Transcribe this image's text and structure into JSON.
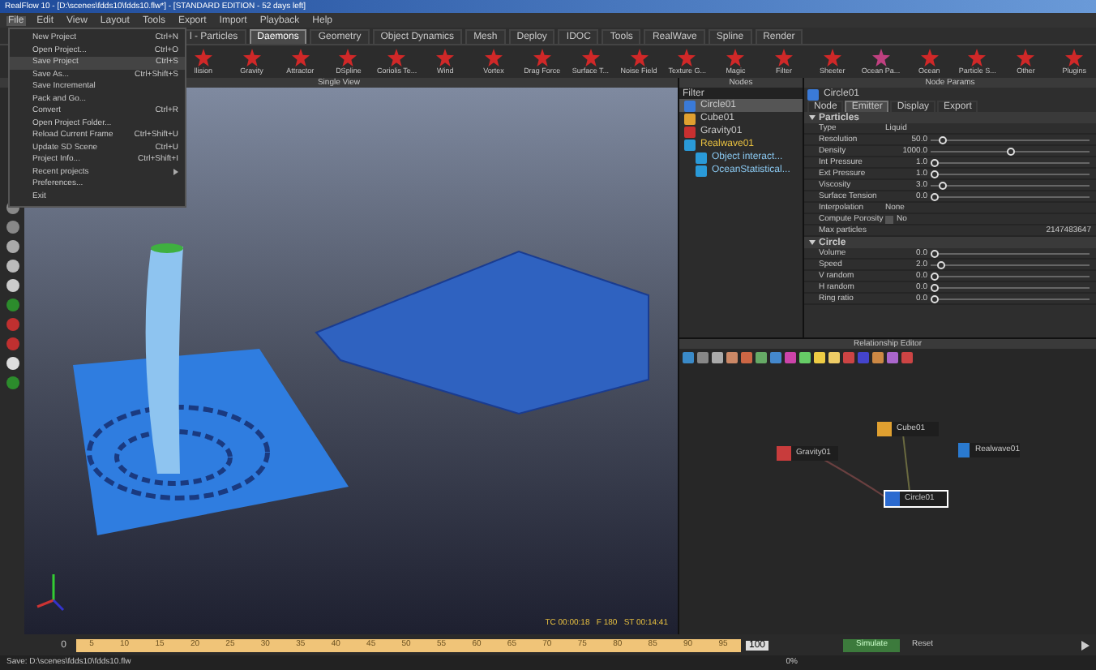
{
  "window": {
    "title": "RealFlow 10 - [D:\\scenes\\fdds10\\fdds10.flw*] - [STANDARD EDITION - 52 days left]"
  },
  "menu_bar": [
    {
      "label": "File",
      "selected": true
    },
    {
      "label": "Edit",
      "selected": false
    },
    {
      "label": "View",
      "selected": false
    },
    {
      "label": "Layout",
      "selected": false
    },
    {
      "label": "Tools",
      "selected": false
    },
    {
      "label": "Export",
      "selected": false
    },
    {
      "label": "Import",
      "selected": false
    },
    {
      "label": "Playback",
      "selected": false
    },
    {
      "label": "Help",
      "selected": false
    }
  ],
  "file_menu": [
    {
      "kind": "item",
      "label": "New Project",
      "shortcut": "Ctrl+N",
      "selected": false
    },
    {
      "kind": "item",
      "label": "Open Project...",
      "shortcut": "Ctrl+O",
      "selected": false
    },
    {
      "kind": "item",
      "label": "Save Project",
      "shortcut": "Ctrl+S",
      "selected": true
    },
    {
      "kind": "item",
      "label": "Save As...",
      "shortcut": "Ctrl+Shift+S",
      "selected": false
    },
    {
      "kind": "item",
      "label": "Save Incremental",
      "selected": false
    },
    {
      "kind": "item",
      "label": "Pack and Go...",
      "selected": false
    },
    {
      "kind": "item",
      "label": "Convert",
      "shortcut": "Ctrl+R",
      "selected": false
    },
    {
      "kind": "item",
      "label": "Open Project Folder...",
      "selected": false
    },
    {
      "kind": "item",
      "label": "Reload Current Frame",
      "shortcut": "Ctrl+Shift+U",
      "selected": false
    },
    {
      "kind": "item",
      "label": "Update SD Scene",
      "shortcut": "Ctrl+U",
      "selected": false
    },
    {
      "kind": "item",
      "label": "Project Info...",
      "shortcut": "Ctrl+Shift+I",
      "selected": false
    },
    {
      "kind": "submenu",
      "label": "Recent projects",
      "selected": false
    },
    {
      "kind": "item",
      "label": "Preferences...",
      "selected": false
    },
    {
      "kind": "item",
      "label": "Exit",
      "selected": false
    }
  ],
  "tabs": [
    {
      "label": "l - Particles",
      "selected": false
    },
    {
      "label": "Daemons",
      "selected": true
    },
    {
      "label": "Geometry",
      "selected": false
    },
    {
      "label": "Object Dynamics",
      "selected": false
    },
    {
      "label": "Mesh",
      "selected": false
    },
    {
      "label": "Deploy",
      "selected": false
    },
    {
      "label": "IDOC",
      "selected": false
    },
    {
      "label": "Tools",
      "selected": false
    },
    {
      "label": "RealWave",
      "selected": false
    },
    {
      "label": "Spline",
      "selected": false
    },
    {
      "label": "Render",
      "selected": false
    }
  ],
  "toolbar": [
    "llision",
    "Gravity",
    "Attractor",
    "DSpline",
    "Coriolis Te...",
    "Wind",
    "Vortex",
    "Drag Force",
    "Surface T...",
    "Noise Field",
    "Texture G...",
    "Magic",
    "Filter",
    "Sheeter",
    "Ocean Pa...",
    "Ocean",
    "Particle S...",
    "Other",
    "Plugins"
  ],
  "viewport": {
    "title": "Single View",
    "readout": "TC 00:00:18   F 180   ST 00:14:41"
  },
  "nodes": {
    "title": "Nodes",
    "filter": "Filter",
    "items": [
      {
        "label": "Circle01",
        "selected": true
      },
      {
        "label": "Cube01",
        "selected": false
      },
      {
        "label": "Gravity01",
        "selected": false
      },
      {
        "label": "Realwave01",
        "selected": false,
        "children": [
          {
            "label": "Object interact...",
            "selected": false
          },
          {
            "label": "OceanStatistical...",
            "selected": false
          }
        ]
      }
    ]
  },
  "node_params": {
    "title": "Node Params",
    "node": "Circle01",
    "tabs": [
      {
        "label": "Node",
        "selected": false
      },
      {
        "label": "Emitter",
        "selected": true
      },
      {
        "label": "Display",
        "selected": false
      },
      {
        "label": "Export",
        "selected": false
      }
    ],
    "sections": [
      {
        "title": "Particles",
        "rows": [
          {
            "kind": "dropdown",
            "label": "Type",
            "value": "Liquid"
          },
          {
            "kind": "slider",
            "label": "Resolution",
            "value": "50.0",
            "level": 0.05
          },
          {
            "kind": "slider",
            "label": "Density",
            "value": "1000.0",
            "level": 0.5
          },
          {
            "kind": "slider",
            "label": "Int Pressure",
            "value": "1.0",
            "level": 0.0
          },
          {
            "kind": "slider",
            "label": "Ext Pressure",
            "value": "1.0",
            "level": 0.0
          },
          {
            "kind": "slider",
            "label": "Viscosity",
            "value": "3.0",
            "level": 0.05
          },
          {
            "kind": "slider",
            "label": "Surface Tension",
            "value": "0.0",
            "level": 0.0
          },
          {
            "kind": "dropdown",
            "label": "Interpolation",
            "value": "None"
          },
          {
            "kind": "checkbox",
            "label": "Compute Porosity",
            "value": "No",
            "checked": false
          },
          {
            "kind": "text",
            "label": "Max particles",
            "value": "2147483647"
          }
        ]
      },
      {
        "title": "Circle",
        "rows": [
          {
            "kind": "slider",
            "label": "Volume",
            "value": "0.0",
            "level": 0.0
          },
          {
            "kind": "slider",
            "label": "Speed",
            "value": "2.0",
            "level": 0.04
          },
          {
            "kind": "slider",
            "label": "V random",
            "value": "0.0",
            "level": 0.0
          },
          {
            "kind": "slider",
            "label": "H random",
            "value": "0.0",
            "level": 0.0
          },
          {
            "kind": "slider",
            "label": "Ring ratio",
            "value": "0.0",
            "level": 0.0
          }
        ]
      }
    ]
  },
  "relationship_editor": {
    "title": "Relationship Editor",
    "nodes": [
      {
        "label": "Gravity01",
        "color": "#c83c3c",
        "selected": false
      },
      {
        "label": "Cube01",
        "color": "#e0a030",
        "selected": false
      },
      {
        "label": "Realwave01",
        "color": "#2a7ad0",
        "selected": false
      },
      {
        "label": "Circle01",
        "color": "#2a6ad0",
        "selected": true
      }
    ]
  },
  "timeline": {
    "start": "0",
    "ticks": [
      "5",
      "10",
      "15",
      "20",
      "25",
      "30",
      "35",
      "40",
      "45",
      "50",
      "55",
      "60",
      "65",
      "70",
      "75",
      "80",
      "85",
      "90",
      "95"
    ],
    "end": "100",
    "simulate": "Simulate",
    "reset": "Reset",
    "progress": "0%"
  },
  "status_bar": "Save: D:\\scenes\\fdds10\\fdds10.flw"
}
